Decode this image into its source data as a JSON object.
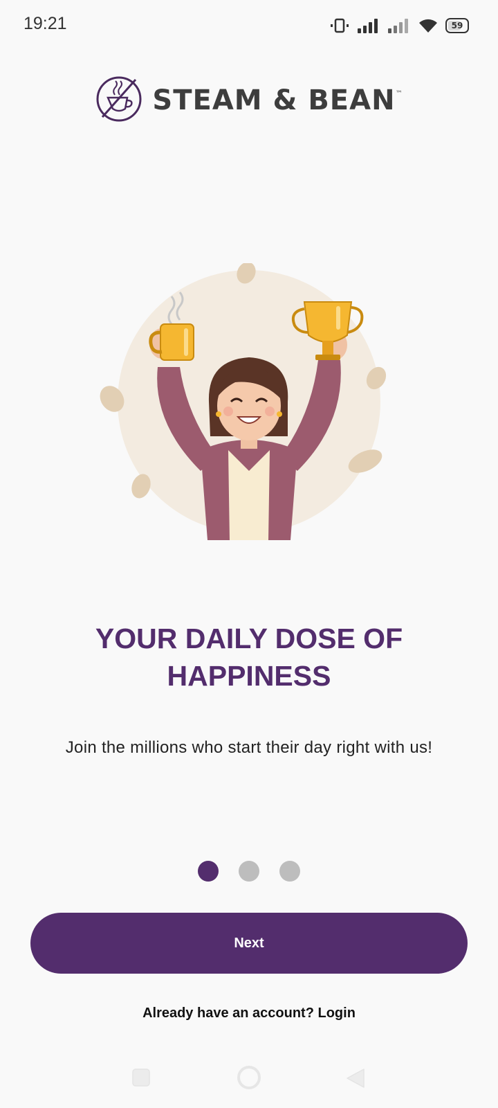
{
  "status_bar": {
    "time": "19:21",
    "battery_level": "59",
    "icons": [
      "vibrate-icon",
      "signal-icon",
      "signal-icon",
      "wifi-icon",
      "battery-icon"
    ]
  },
  "logo": {
    "brand_name": "STEAM & BEAN",
    "trademark": "™"
  },
  "illustration": {
    "description_icon": "woman-holding-coffee-and-trophy-illustration"
  },
  "onboarding": {
    "headline": "YOUR DAILY DOSE OF HAPPINESS",
    "subtitle": "Join the millions who start their day right with us!",
    "page_count": 3,
    "current_page": 1
  },
  "actions": {
    "next_label": "Next",
    "login_prompt": "Already have an account?",
    "login_link": "Login"
  },
  "nav_bar": {
    "icons": [
      "recents-square-icon",
      "home-circle-icon",
      "back-triangle-icon"
    ]
  },
  "colors": {
    "brand": "#532d6d",
    "inactive_dot": "#bdbdbd",
    "background": "#f9f9f9"
  }
}
